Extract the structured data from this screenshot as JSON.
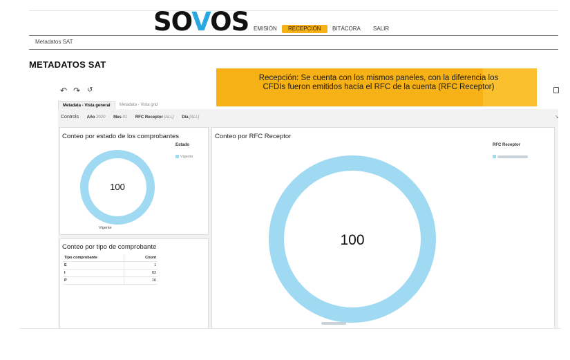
{
  "header": {
    "logo_text": "SOVOS",
    "nav": [
      "EMISIÓN",
      "RECEPCIÓN",
      "BITÁCORA",
      "SALIR"
    ],
    "active_nav": "RECEPCIÓN"
  },
  "breadcrumb": "Metadatos SAT",
  "page_title": "METADATOS SAT",
  "callout": "Recepción: Se cuenta con los mismos paneles, con la diferencia los CFDIs fueron emitidos hacía el RFC de la cuenta (RFC Receptor)",
  "toolbar": {
    "undo_icon": "undo-icon",
    "redo_icon": "redo-icon",
    "reset_icon": "reset-icon",
    "print_icon": "printer-icon"
  },
  "tabs": [
    "Metadata - Vista general",
    "Metadata - Vista grid"
  ],
  "controls": {
    "label": "Controls",
    "items": [
      {
        "label": "Año",
        "value": "2020"
      },
      {
        "label": "Mes",
        "value": "01"
      },
      {
        "label": "RFC Receptor",
        "value": "[ALL]"
      },
      {
        "label": "Día",
        "value": "[ALL]"
      }
    ]
  },
  "panel_estado": {
    "title": "Conteo por estado de los comprobantes",
    "legend_title": "Estado",
    "legend_item": "Vigente",
    "center_value": "100",
    "slice_label": "Vigente",
    "color": "#9fd9f2"
  },
  "panel_tipo": {
    "title": "Conteo por tipo de comprobante",
    "columns": [
      "Tipo comprobante",
      "Count"
    ],
    "rows": [
      {
        "tipo": "E",
        "count": "1"
      },
      {
        "tipo": "I",
        "count": "83"
      },
      {
        "tipo": "P",
        "count": "16"
      }
    ]
  },
  "panel_rfc": {
    "title": "Conteo por RFC Receptor",
    "legend_title": "RFC Receptor",
    "center_value": "100",
    "color": "#9fd9f2"
  }
}
